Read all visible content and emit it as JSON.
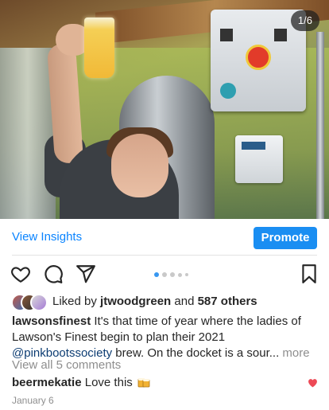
{
  "photo": {
    "counter": "1/6"
  },
  "insights": {
    "view_label": "View Insights",
    "promote_label": "Promote"
  },
  "carousel": {
    "total_dots": 5,
    "active_index": 0
  },
  "likes": {
    "prefix": "Liked by",
    "user": "jtwoodgreen",
    "conjunction": "and",
    "others": "587 others"
  },
  "caption": {
    "username": "lawsonsfinest",
    "text_before_mention": "It's that time of year where the ladies of Lawson's Finest begin to plan their 2021",
    "mention": "@pinkbootssociety",
    "text_after_mention": "brew. On the docket is a sour...",
    "more_label": "more"
  },
  "comments": {
    "view_all_label": "View all 5 comments",
    "top_comment": {
      "username": "beermekatie",
      "text": "Love this"
    }
  },
  "post": {
    "date": "January 6"
  },
  "colors": {
    "link_blue": "#0a84ff",
    "promote_bg": "#1a8ef2",
    "active_dot": "#3897f0",
    "heart_red": "#ed4956"
  }
}
